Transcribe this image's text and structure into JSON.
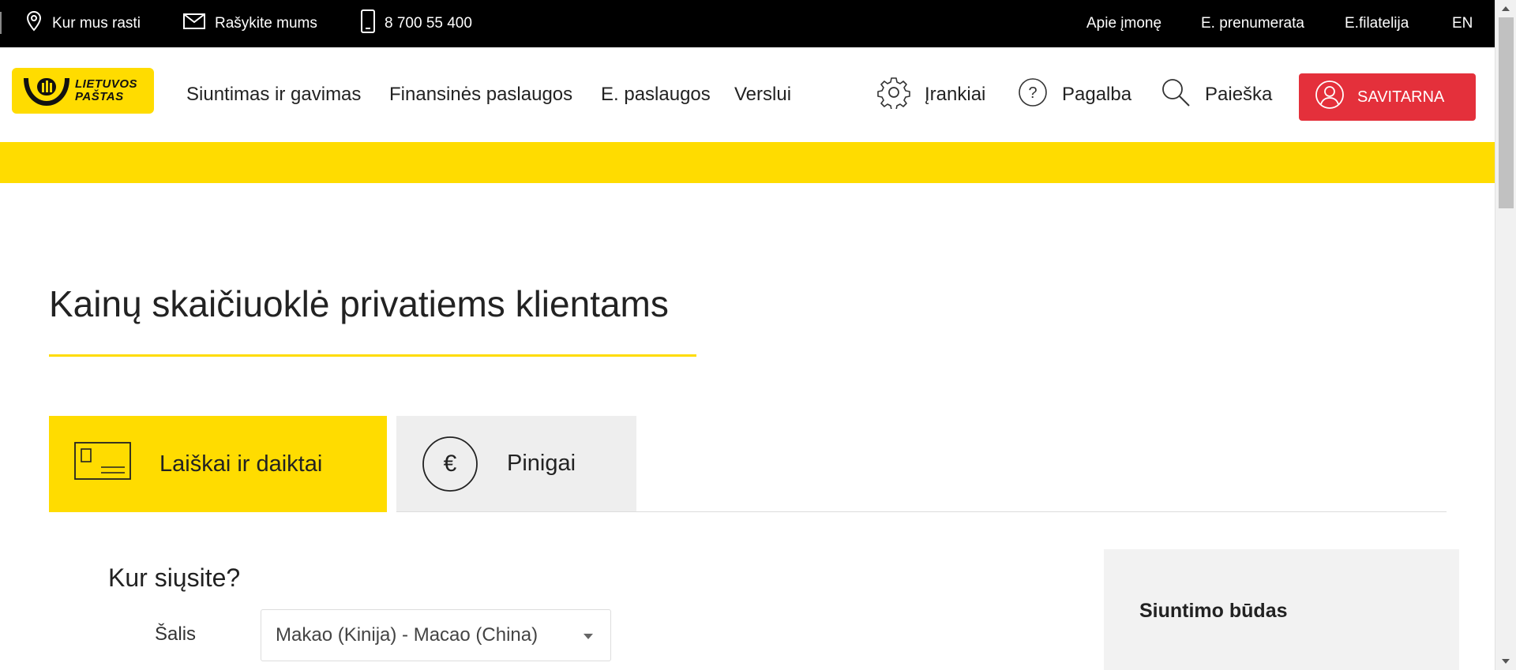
{
  "topbar": {
    "where_to_find": "Kur mus rasti",
    "write_us": "Rašykite mums",
    "phone": "8 700 55 400",
    "about": "Apie įmonę",
    "e_subscription": "E. prenumerata",
    "e_philately": "E.filatelija",
    "language": "EN"
  },
  "logo": {
    "line1": "LIETUVOS",
    "line2": "PAŠTAS"
  },
  "nav": {
    "items": [
      {
        "label": "Siuntimas ir gavimas"
      },
      {
        "label": "Finansinės paslaugos"
      },
      {
        "label": "E. paslaugos"
      },
      {
        "label": "Verslui"
      }
    ]
  },
  "utilities": {
    "tools": "Įrankiai",
    "help": "Pagalba",
    "search": "Paieška",
    "self_service": "SAVITARNA"
  },
  "page": {
    "title": "Kainų skaičiuoklė privatiems klientams"
  },
  "tabs": {
    "letters": "Laiškai ir daiktai",
    "money": "Pinigai",
    "money_symbol": "€"
  },
  "form": {
    "question": "Kur siųsite?",
    "country_label": "Šalis",
    "country_value": "Makao (Kinija) - Macao (China)"
  },
  "side_panel": {
    "title": "Siuntimo būdas"
  },
  "colors": {
    "brand_yellow": "#ffdc00",
    "accent_red": "#e4303b",
    "topbar_black": "#000000"
  }
}
